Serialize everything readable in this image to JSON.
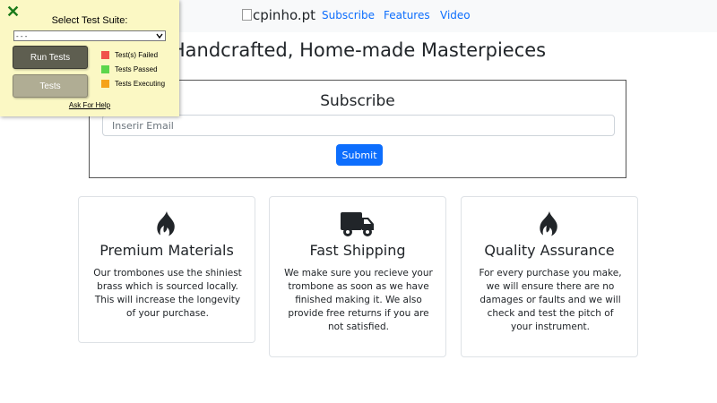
{
  "navbar": {
    "brand": "cpinho.pt",
    "links": [
      "Subscribe",
      "Features",
      "Video"
    ]
  },
  "headline": "Handcrafted, Home-made Masterpieces",
  "subscribe": {
    "title": "Subscribe",
    "email_placeholder": "Inserir Email",
    "submit_label": "Submit",
    "submit_color": "#0d6efd"
  },
  "features": [
    {
      "icon": "fire-icon",
      "title": "Premium Materials",
      "text": "Our trombones use the shiniest brass which is sourced locally. This will increase the longevity of your purchase."
    },
    {
      "icon": "truck-icon",
      "title": "Fast Shipping",
      "text": "We make sure you recieve your trombone as soon as we have finished making it. We also provide free returns if you are not satisfied."
    },
    {
      "icon": "fire-icon",
      "title": "Quality Assurance",
      "text": "For every purchase you make, we will ensure there are no damages or faults and we will check and test the pitch of your instrument."
    }
  ],
  "test_panel": {
    "close_symbol": "✕",
    "suite_label": "Select Test Suite:",
    "suite_selected": "- - -",
    "run_button": "Run Tests",
    "tests_button": "Tests",
    "legend": [
      {
        "label": "Test(s) Failed",
        "color": "#f0524b"
      },
      {
        "label": "Tests Passed",
        "color": "#5cd64c"
      },
      {
        "label": "Tests Executing",
        "color": "#f5a31a"
      }
    ],
    "help_link": "Ask For Help"
  }
}
